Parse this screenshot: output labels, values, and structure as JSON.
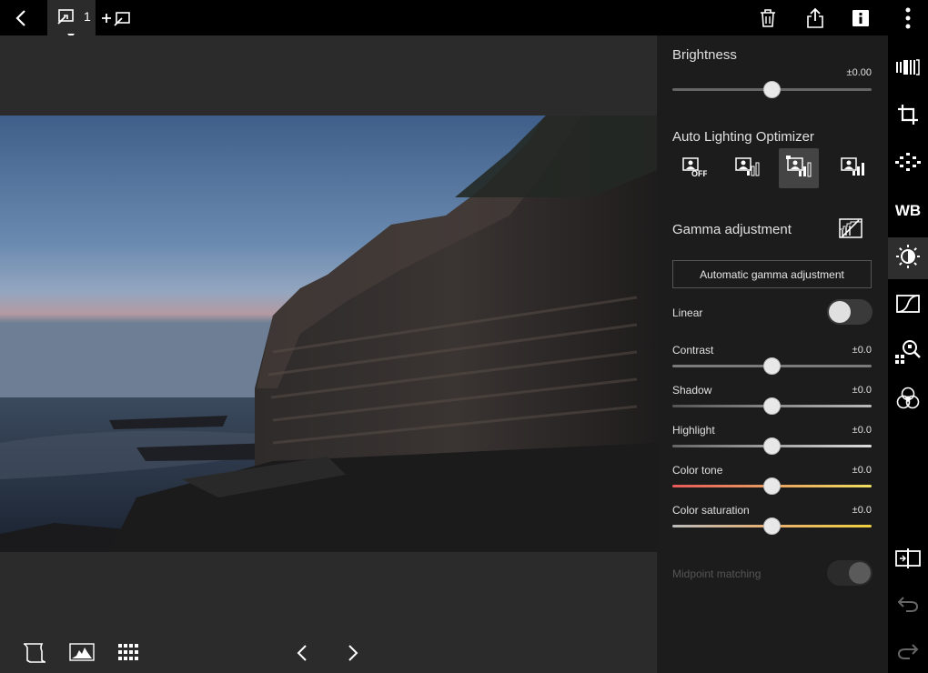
{
  "topbar": {
    "back_icon": "chevron-left-icon",
    "rating_icon": "rating-edit-icon",
    "rating_value": "1",
    "add_rating_icon": "add-rating-icon",
    "trash_icon": "trash-icon",
    "share_icon": "share-icon",
    "info_icon": "info-icon",
    "more_icon": "more-vertical-icon"
  },
  "panel": {
    "brightness": {
      "label": "Brightness",
      "value": "±0.00",
      "position": 0.5
    },
    "alo": {
      "label": "Auto Lighting Optimizer",
      "options": [
        "alo-off-icon",
        "alo-low-icon",
        "alo-standard-icon",
        "alo-high-icon"
      ],
      "selected_index": 2
    },
    "gamma": {
      "label": "Gamma adjustment",
      "auto_button": "Automatic gamma adjustment"
    },
    "linear": {
      "label": "Linear",
      "on": false
    },
    "sliders": [
      {
        "label": "Contrast",
        "value": "±0.0",
        "position": 0.5
      },
      {
        "label": "Shadow",
        "value": "±0.0",
        "position": 0.5
      },
      {
        "label": "Highlight",
        "value": "±0.0",
        "position": 0.5
      },
      {
        "label": "Color tone",
        "value": "±0.0",
        "position": 0.5
      },
      {
        "label": "Color saturation",
        "value": "±0.0",
        "position": 0.5
      }
    ],
    "midpoint": {
      "label": "Midpoint matching",
      "enabled": false
    }
  },
  "sidebar": {
    "items": [
      {
        "icon": "tone-curve-presets-icon"
      },
      {
        "icon": "crop-icon"
      },
      {
        "icon": "lens-correction-icon"
      },
      {
        "icon": "white-balance-icon",
        "text": "WB"
      },
      {
        "icon": "brightness-icon",
        "active": true
      },
      {
        "icon": "tone-curve-icon"
      },
      {
        "icon": "detail-zoom-icon"
      },
      {
        "icon": "color-icon"
      }
    ],
    "compare_icon": "compare-icon",
    "undo_icon": "undo-icon",
    "redo_icon": "redo-icon"
  },
  "bottombar": {
    "scroll_icon": "filmstrip-scroll-icon",
    "histogram_icon": "histogram-icon",
    "grid_icon": "grid-icon",
    "prev_icon": "chevron-left-icon",
    "next_icon": "chevron-right-icon"
  },
  "colors": {
    "background": "#2b2b2b",
    "panel": "#1c1c1c",
    "topbar": "#000000",
    "knob": "#e8e8e8"
  }
}
